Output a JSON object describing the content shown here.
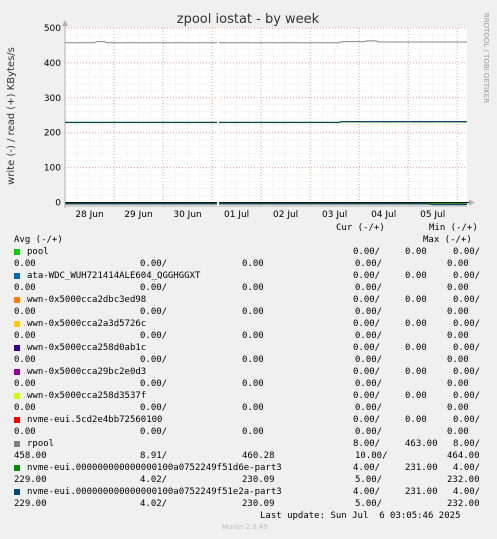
{
  "chart_data": {
    "type": "line",
    "title": "zpool iostat - by week",
    "ylabel": "write (-) / read (+) KBytes/s",
    "side_label": "RRDTOOL / TOBI OETIKER",
    "ylim": [
      -10,
      500
    ],
    "yticks": [
      "500",
      "400",
      "300",
      "200",
      "100",
      "0"
    ],
    "ytick_values": [
      500,
      400,
      300,
      200,
      100,
      0
    ],
    "x_start_day": 0,
    "x_end_day": 8.2,
    "categories": [
      "28 Jun",
      "29 Jun",
      "30 Jun",
      "01 Jul",
      "02 Jul",
      "03 Jul",
      "04 Jul",
      "05 Jul"
    ],
    "category_days": [
      0.5,
      1.5,
      2.5,
      3.5,
      4.5,
      5.5,
      6.5,
      7.5
    ],
    "gap_day": [
      3.1,
      3.12
    ],
    "series": [
      {
        "name": "rpool",
        "color": "#888888",
        "points": [
          [
            0,
            458
          ],
          [
            0.6,
            458
          ],
          [
            0.65,
            461
          ],
          [
            0.8,
            461
          ],
          [
            0.85,
            458
          ],
          [
            2.4,
            458
          ],
          [
            5.6,
            458
          ],
          [
            5.65,
            461
          ],
          [
            6.1,
            461
          ],
          [
            6.15,
            463
          ],
          [
            6.35,
            463
          ],
          [
            6.4,
            460
          ],
          [
            7.5,
            460
          ],
          [
            8.2,
            460
          ]
        ]
      },
      {
        "name": "rpool",
        "color": "#888888",
        "points": [
          [
            0,
            -5
          ],
          [
            8.2,
            -5
          ]
        ]
      },
      {
        "name": "nvme-eui.000000000000000100a0752249f51d6e-part3",
        "color": "#008000",
        "points": [
          [
            0,
            229
          ],
          [
            5.6,
            229
          ],
          [
            5.65,
            231
          ],
          [
            8.2,
            231
          ]
        ]
      },
      {
        "name": "nvme-eui.000000000000000100a0752249f51e2a-part3",
        "color": "#0b3c66",
        "points": [
          [
            0,
            230
          ],
          [
            5.6,
            230
          ],
          [
            5.65,
            232
          ],
          [
            8.2,
            232
          ]
        ]
      },
      {
        "name": "nvme-eui.000000000000000100a0752249f51d6e-part3",
        "color": "#008000",
        "points": [
          [
            0,
            -2
          ],
          [
            8.2,
            -2
          ]
        ]
      },
      {
        "name": "nvme-eui.000000000000000100a0752249f51e2a-part3",
        "color": "#0b3c66",
        "points": [
          [
            0,
            -3
          ],
          [
            7.4,
            -3
          ],
          [
            7.5,
            -6
          ],
          [
            8.2,
            -6
          ]
        ]
      }
    ]
  },
  "legend": {
    "header_cur": "Cur (-/+)",
    "header_min": "Min (-/+)",
    "header_avg": "Avg (-/+)",
    "header_max": "Max (-/+)",
    "rows": [
      {
        "name": "pool",
        "color": "#00cc00",
        "cur": "0.00/",
        "min": "0.00",
        "cur2": "0.00/",
        "avg1": "0.00",
        "avg2": "0.00/",
        "avg3": "0.00",
        "max": "0.00/",
        "max2": "0.00"
      },
      {
        "name": "ata-WDC_WUH721414ALE604_QGGHGGXT",
        "color": "#0066b3",
        "cur": "0.00/",
        "min": "0.00",
        "cur2": "0.00/",
        "avg1": "0.00",
        "avg2": "0.00/",
        "avg3": "0.00",
        "max": "0.00/",
        "max2": "0.00"
      },
      {
        "name": "wwn-0x5000cca2dbc3ed98",
        "color": "#ff8000",
        "cur": "0.00/",
        "min": "0.00",
        "cur2": "0.00/",
        "avg1": "0.00",
        "avg2": "0.00/",
        "avg3": "0.00",
        "max": "0.00/",
        "max2": "0.00"
      },
      {
        "name": "wwn-0x5000cca2a3d5726c",
        "color": "#ffcc00",
        "cur": "0.00/",
        "min": "0.00",
        "cur2": "0.00/",
        "avg1": "0.00",
        "avg2": "0.00/",
        "avg3": "0.00",
        "max": "0.00/",
        "max2": "0.00"
      },
      {
        "name": "wwn-0x5000cca258d0ab1c",
        "color": "#330099",
        "cur": "0.00/",
        "min": "0.00",
        "cur2": "0.00/",
        "avg1": "0.00",
        "avg2": "0.00/",
        "avg3": "0.00",
        "max": "0.00/",
        "max2": "0.00"
      },
      {
        "name": "wwn-0x5000cca29bc2e0d3",
        "color": "#990099",
        "cur": "0.00/",
        "min": "0.00",
        "cur2": "0.00/",
        "avg1": "0.00",
        "avg2": "0.00/",
        "avg3": "0.00",
        "max": "0.00/",
        "max2": "0.00"
      },
      {
        "name": "wwn-0x5000cca258d3537f",
        "color": "#ccff00",
        "cur": "0.00/",
        "min": "0.00",
        "cur2": "0.00/",
        "avg1": "0.00",
        "avg2": "0.00/",
        "avg3": "0.00",
        "max": "0.00/",
        "max2": "0.00"
      },
      {
        "name": "nvme-eui.5cd2e4bb72560100",
        "color": "#ff0000",
        "cur": "0.00/",
        "min": "0.00",
        "cur2": "0.00/",
        "avg1": "0.00",
        "avg2": "0.00/",
        "avg3": "0.00",
        "max": "0.00/",
        "max2": "0.00"
      },
      {
        "name": "rpool",
        "color": "#808080",
        "cur": "8.00/",
        "min": "463.00",
        "cur2": "8.00/",
        "avg1": "458.00",
        "avg2": "8.91/",
        "avg3": "460.28",
        "max": "10.00/",
        "max2": "464.00"
      },
      {
        "name": "nvme-eui.000000000000000100a0752249f51d6e-part3",
        "color": "#008f00",
        "cur": "4.00/",
        "min": "231.00",
        "cur2": "4.00/",
        "avg1": "229.00",
        "avg2": "4.02/",
        "avg3": "230.09",
        "max": "5.00/",
        "max2": "232.00"
      },
      {
        "name": "nvme-eui.000000000000000100a0752249f51e2a-part3",
        "color": "#00487d",
        "cur": "4.00/",
        "min": "231.00",
        "cur2": "4.00/",
        "avg1": "229.00",
        "avg2": "4.02/",
        "avg3": "230.09",
        "max": "5.00/",
        "max2": "232.00"
      }
    ],
    "last_update": "Last update: Sun Jul  6 03:05:46 2025",
    "footer": "Munin 2.0.49"
  }
}
